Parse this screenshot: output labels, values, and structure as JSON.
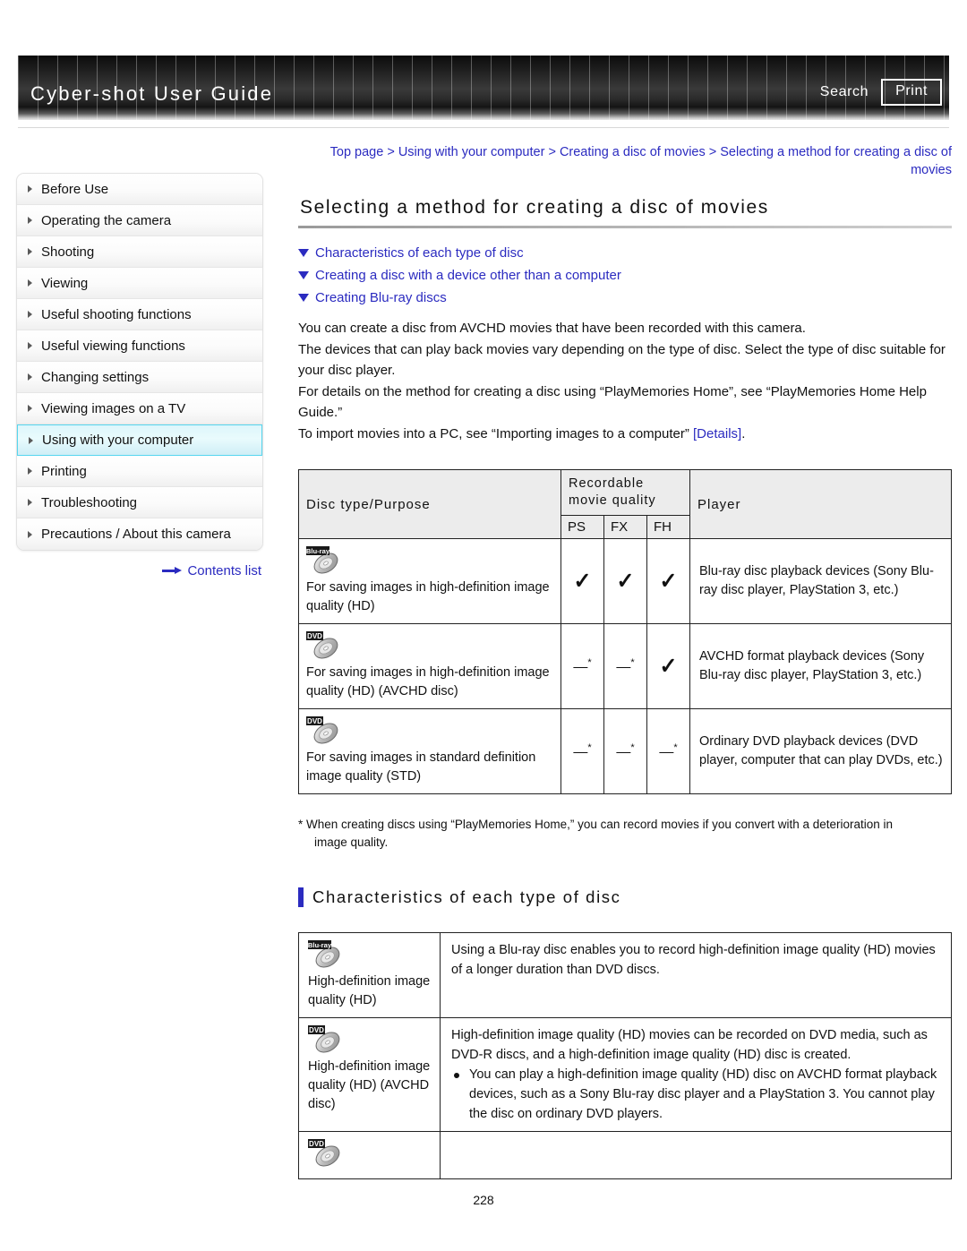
{
  "header": {
    "title": "Cyber-shot User Guide",
    "search_label": "Search",
    "print_label": "Print"
  },
  "sidebar": {
    "items": [
      {
        "label": "Before Use",
        "selected": false
      },
      {
        "label": "Operating the camera",
        "selected": false
      },
      {
        "label": "Shooting",
        "selected": false
      },
      {
        "label": "Viewing",
        "selected": false
      },
      {
        "label": "Useful shooting functions",
        "selected": false
      },
      {
        "label": "Useful viewing functions",
        "selected": false
      },
      {
        "label": "Changing settings",
        "selected": false
      },
      {
        "label": "Viewing images on a TV",
        "selected": false
      },
      {
        "label": "Using with your computer",
        "selected": true
      },
      {
        "label": "Printing",
        "selected": false
      },
      {
        "label": "Troubleshooting",
        "selected": false
      },
      {
        "label": "Precautions / About this camera",
        "selected": false
      }
    ],
    "contents_list_label": "Contents list"
  },
  "main": {
    "breadcrumb": "Top page > Using with your computer > Creating a disc of movies > Selecting a method for creating a disc of movies",
    "page_title": "Selecting a method for creating a disc of movies",
    "anchor_links": [
      "Characteristics of each type of disc",
      "Creating a disc with a device other than a computer",
      "Creating Blu-ray discs"
    ],
    "intro": {
      "line1": "You can create a disc from AVCHD movies that have been recorded with this camera.",
      "line2": "The devices that can play back movies vary depending on the type of disc. Select the type of disc suitable for your disc player.",
      "line3": "For details on the method for creating a disc using “PlayMemories Home”, see “PlayMemories Home Help Guide.”",
      "line4_prefix": "To import movies into a PC, see “Importing images to a computer” ",
      "line4_link": "[Details]",
      "line4_suffix": "."
    },
    "disc_table": {
      "headers": {
        "disc_type": "Disc type/Purpose",
        "recordable_quality": "Recordable movie quality",
        "quality_codes": [
          "PS",
          "FX",
          "FH"
        ],
        "player": "Player"
      },
      "rows": [
        {
          "icon": "blu-ray-disc-icon",
          "icon_label": "Blu-ray",
          "description": "For saving images in high-definition image quality (HD)",
          "marks": [
            "check",
            "check",
            "check"
          ],
          "player": "Blu-ray disc playback devices (Sony Blu-ray disc player, PlayStation 3, etc.)"
        },
        {
          "icon": "dvd-disc-icon",
          "icon_label": "DVD",
          "description": "For saving images in high-definition image quality (HD) (AVCHD disc)",
          "marks": [
            "dash",
            "dash",
            "check"
          ],
          "player": "AVCHD format playback devices (Sony Blu-ray disc player, PlayStation 3, etc.)"
        },
        {
          "icon": "dvd-disc-icon",
          "icon_label": "DVD",
          "description": "For saving images in standard definition image quality (STD)",
          "marks": [
            "dash",
            "dash",
            "dash"
          ],
          "player": "Ordinary DVD playback devices (DVD player, computer that can play DVDs, etc.)"
        }
      ]
    },
    "footnote": {
      "line1": "* When creating discs using “PlayMemories Home,” you can record movies if you convert with a deterioration in",
      "line2": "image quality."
    },
    "section_heading": "Characteristics of each type of disc",
    "char_table": {
      "rows": [
        {
          "icon": "blu-ray-disc-icon",
          "icon_label": "Blu-ray",
          "label": "High-definition image quality (HD)",
          "body": "Using a Blu-ray disc enables you to record high-definition image quality (HD) movies of a longer duration than DVD discs.",
          "bullets": []
        },
        {
          "icon": "dvd-disc-icon",
          "icon_label": "DVD",
          "label": "High-definition image quality (HD) (AVCHD disc)",
          "body": "High-definition image quality (HD) movies can be recorded on DVD media, such as DVD-R discs, and a high-definition image quality (HD) disc is created.",
          "bullets": [
            "You can play a high-definition image quality (HD) disc on AVCHD format playback devices, such as a Sony Blu-ray disc player and a PlayStation 3. You cannot play the disc on ordinary DVD players."
          ]
        },
        {
          "icon": "dvd-disc-icon",
          "icon_label": "DVD",
          "label": "",
          "body": "",
          "bullets": []
        }
      ]
    },
    "page_number": "228"
  },
  "colors": {
    "link": "#2b2bc0",
    "selected_border": "#57d6ef",
    "table_border": "#222222",
    "header_cell_bg": "#ececec"
  }
}
